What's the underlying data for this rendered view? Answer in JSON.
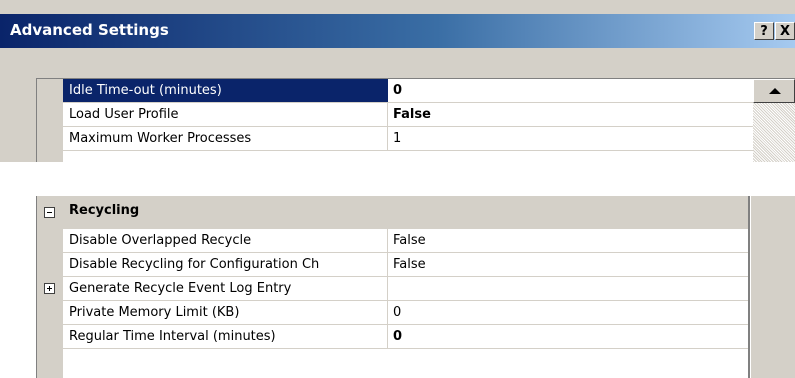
{
  "window": {
    "title": "Advanced Settings",
    "help_btn": "?",
    "close_btn": "X"
  },
  "top_grid": {
    "rows": [
      {
        "name": "Idle Time-out (minutes)",
        "value": "0"
      },
      {
        "name": "Load User Profile",
        "value": "False"
      },
      {
        "name": "Maximum Worker Processes",
        "value": "1"
      }
    ]
  },
  "bottom_grid": {
    "category": "Recycling",
    "rows": [
      {
        "name": "Disable Overlapped Recycle",
        "value": "False"
      },
      {
        "name": "Disable Recycling for Configuration Ch",
        "value": "False"
      },
      {
        "name": "Generate Recycle Event Log Entry",
        "value": ""
      },
      {
        "name": "Private Memory Limit (KB)",
        "value": "0"
      },
      {
        "name": "Regular Time Interval (minutes)",
        "value": "0"
      }
    ]
  },
  "colors": {
    "title_bar": "#0a246a",
    "selection": "#0a246a",
    "face": "#d4d0c8"
  }
}
